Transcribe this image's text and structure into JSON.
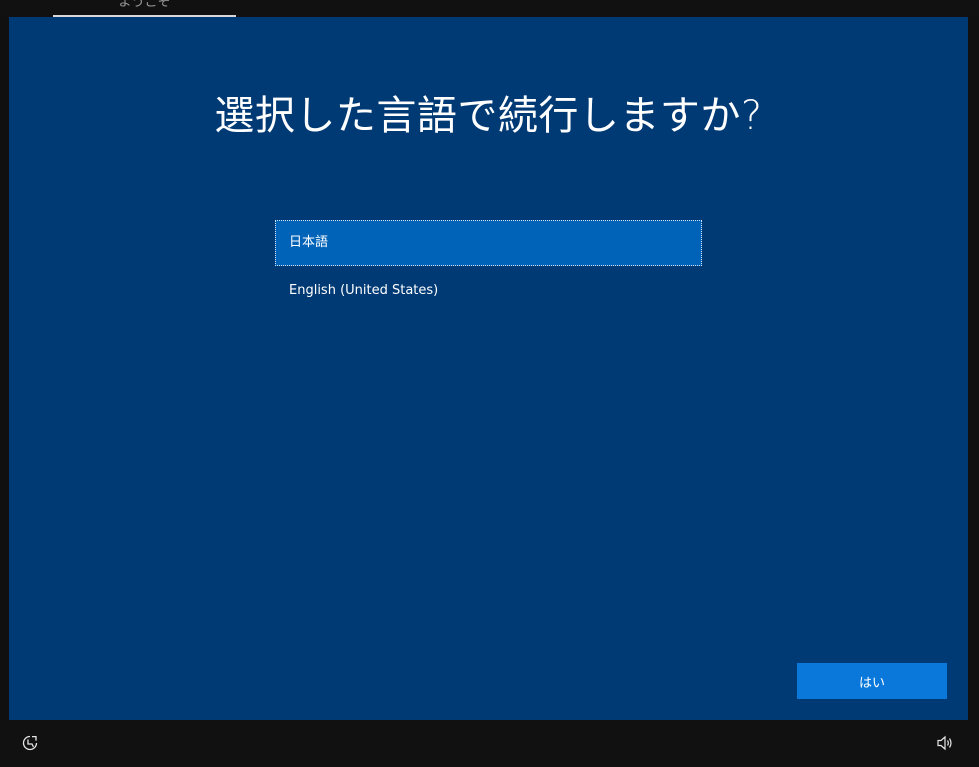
{
  "top_tab": {
    "label": "ようこそ"
  },
  "main": {
    "title": "選択した言語で続行しますか?",
    "languages": [
      {
        "label": "日本語",
        "selected": true
      },
      {
        "label": "English (United States)",
        "selected": false
      }
    ],
    "yes_button_label": "はい"
  },
  "taskbar": {
    "left_icon": "ease-of-access-icon",
    "right_icon": "volume-icon"
  },
  "colors": {
    "panel_bg": "#003a75",
    "selected_item_bg": "#0063b8",
    "button_bg": "#0a78db",
    "chrome_bg": "#111111"
  }
}
